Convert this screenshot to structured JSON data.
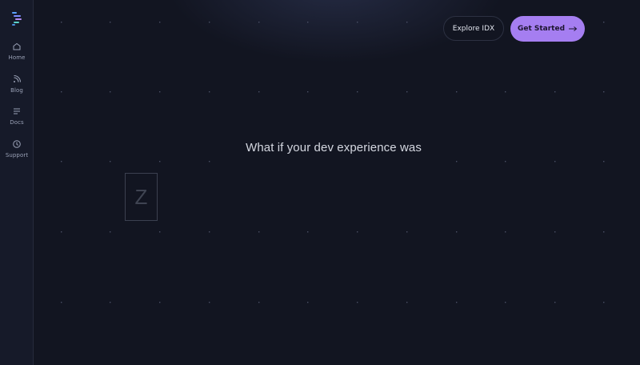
{
  "sidebar": {
    "logo_icon": "idx-logo-icon",
    "items": [
      {
        "label": "Home",
        "icon": "home-icon"
      },
      {
        "label": "Blog",
        "icon": "rss-icon"
      },
      {
        "label": "Docs",
        "icon": "docs-icon"
      },
      {
        "label": "Support",
        "icon": "support-icon"
      }
    ]
  },
  "header": {
    "explore_label": "Explore IDX",
    "start_label": "Get Started",
    "start_icon": "arrow-right-icon"
  },
  "hero": {
    "headline": "What if your dev experience was",
    "letter": "Z"
  },
  "colors": {
    "background": "#121521",
    "sidebar": "#161a29",
    "accent": "#a57ef1",
    "text": "#d4d7e0"
  }
}
